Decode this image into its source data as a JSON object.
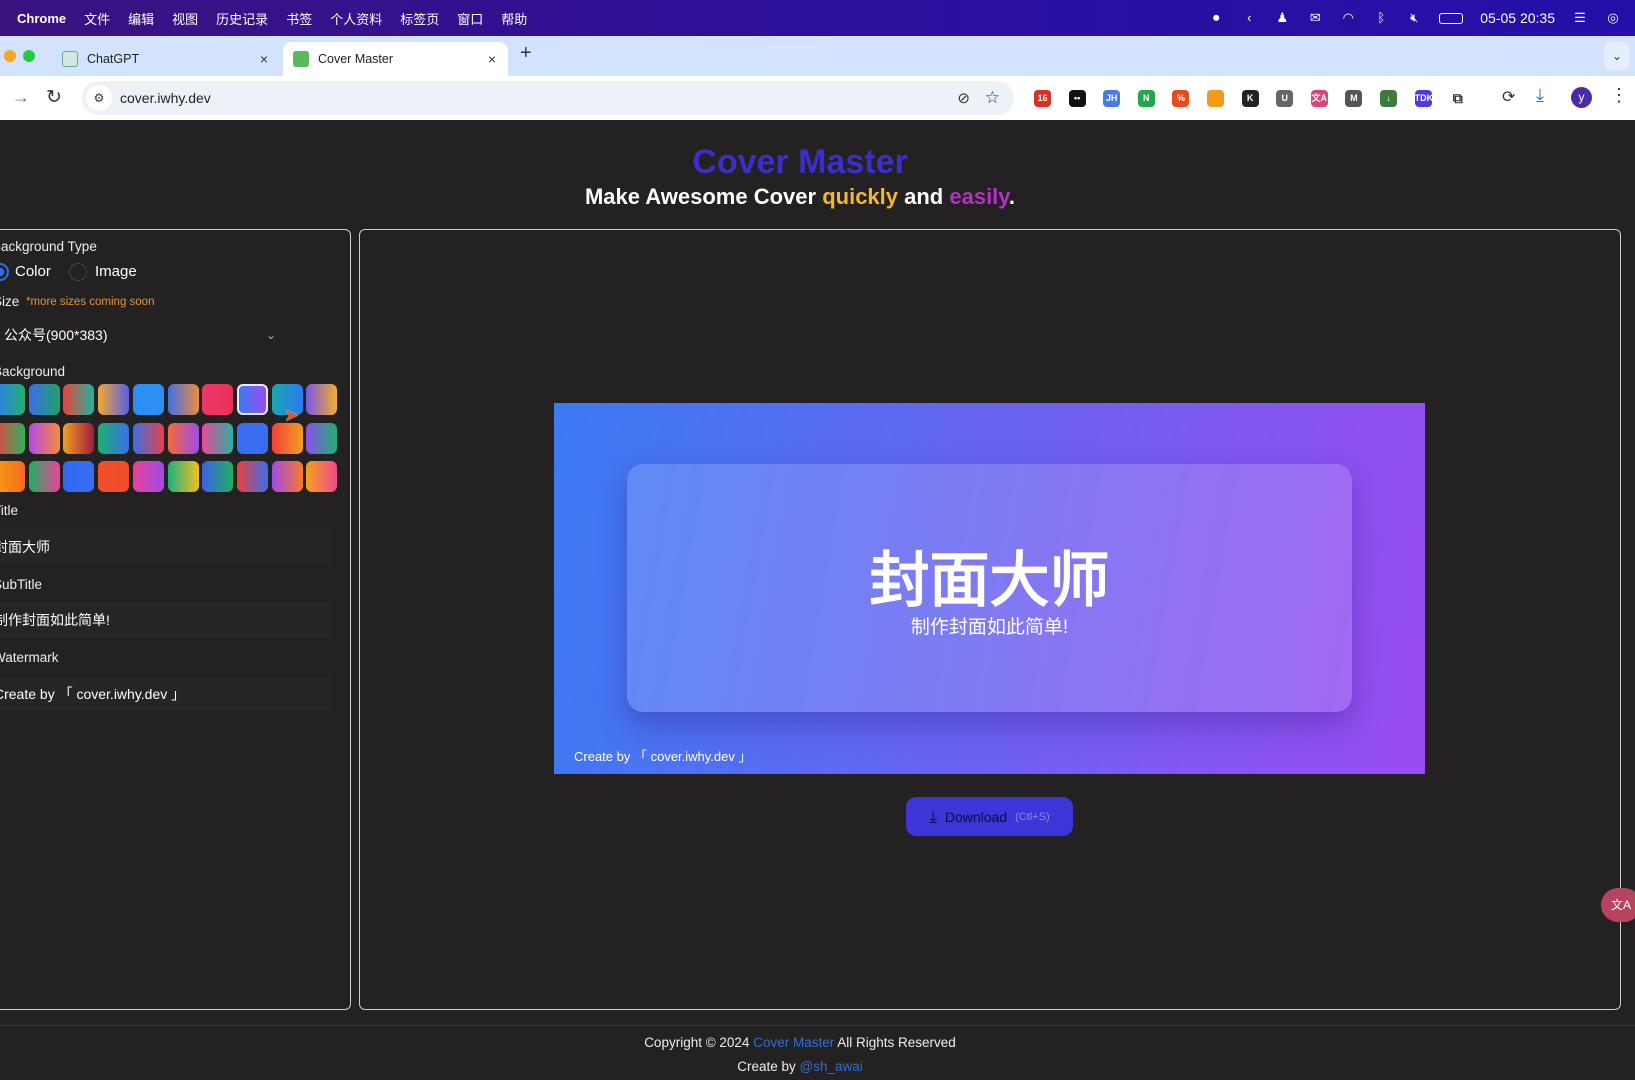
{
  "menubar": {
    "app": "Chrome",
    "items": [
      "文件",
      "编辑",
      "视图",
      "历史记录",
      "书签",
      "个人资料",
      "标签页",
      "窗口",
      "帮助"
    ],
    "clock": "05-05 20:35"
  },
  "tabs": [
    {
      "label": "ChatGPT",
      "close": "×"
    },
    {
      "label": "Cover Master",
      "close": "×"
    }
  ],
  "new_tab": "+",
  "address": {
    "url": "cover.iwhy.dev"
  },
  "extensions": [
    {
      "name": "badge-extension-icon",
      "text": "16",
      "color": "#d93025"
    },
    {
      "name": "glasses-extension-icon",
      "text": "••",
      "color": "#111"
    },
    {
      "name": "jh-extension-icon",
      "text": "JH",
      "color": "#4a7be0"
    },
    {
      "name": "n-extension-icon",
      "text": "N",
      "color": "#22a84a"
    },
    {
      "name": "percent-extension-icon",
      "text": "%",
      "color": "#e84a1a"
    },
    {
      "name": "swirl-extension-icon",
      "text": "",
      "color": "#f29a1a"
    },
    {
      "name": "k-extension-icon",
      "text": "K",
      "color": "#222"
    },
    {
      "name": "shield-extension-icon",
      "text": "U",
      "color": "#666"
    },
    {
      "name": "translate-extension-icon",
      "text": "文A",
      "color": "#d9467a"
    },
    {
      "name": "m-extension-icon",
      "text": "M",
      "color": "#555"
    },
    {
      "name": "mic-extension-icon",
      "text": "↓",
      "color": "#3d7a3d"
    },
    {
      "name": "tdk-extension-icon",
      "text": "TDK",
      "color": "#4a3ae0"
    },
    {
      "name": "puzzle-extension-icon",
      "text": "⧉",
      "color": "#fff"
    }
  ],
  "profile": "y",
  "header": {
    "brand": "Cover Master",
    "tag_pre": "Make Awesome Cover ",
    "tag_q": "quickly",
    "tag_mid": " and ",
    "tag_e": "easily",
    "tag_end": ".",
    "accent": "#3b2fc9",
    "quick_color": "#f5b731",
    "easy_color": "#b630c8"
  },
  "form": {
    "bg_type_label": "Background Type",
    "bg_type_options": [
      "Color",
      "Image"
    ],
    "bg_type_selected": "Color",
    "size_label": "Size",
    "size_note": "*more sizes coming soon",
    "size_value": "公众号(900*383)",
    "background_label": "Background",
    "swatches": [
      [
        "#2f7bf5",
        "#22b06a"
      ],
      [
        "#3a6ee8",
        "#1fa26a"
      ],
      [
        "#e8433a",
        "#20b3a0"
      ],
      [
        "#f2a830",
        "#5a5ee8"
      ],
      [
        "#2b8ff2",
        "#2f8ff5"
      ],
      [
        "#3f6fe8",
        "#f28a3a"
      ],
      [
        "#f0366a",
        "#e8305a"
      ],
      [
        "#3b7bf3",
        "#9a4cf0"
      ],
      [
        "#18a8b0",
        "#2a7af0"
      ],
      [
        "#7a55e8",
        "#f2b02a"
      ],
      [
        "#e84040",
        "#30b060"
      ],
      [
        "#b04ae8",
        "#f88a3a"
      ],
      [
        "#f2a020",
        "#a01a40"
      ],
      [
        "#20b070",
        "#3a6ee8"
      ],
      [
        "#3a6ee8",
        "#e8404a"
      ],
      [
        "#f26a3a",
        "#a04ae8"
      ],
      [
        "#e84a9a",
        "#2ab0a0"
      ],
      [
        "#3a6ef0",
        "#3a6ef0"
      ],
      [
        "#f0403a",
        "#f2a020"
      ],
      [
        "#8a50e8",
        "#20b070"
      ],
      [
        "#f2a010",
        "#f86a20"
      ],
      [
        "#20b060",
        "#f0409a"
      ],
      [
        "#2f68f5",
        "#3a6ef0"
      ],
      [
        "#f0502a",
        "#f04a2a"
      ],
      [
        "#e8409a",
        "#a04ae8"
      ],
      [
        "#20b080",
        "#f2c020"
      ],
      [
        "#3a60e8",
        "#20b060"
      ],
      [
        "#e8403a",
        "#3a6ef0"
      ],
      [
        "#a04ae8",
        "#f87a2a"
      ],
      [
        "#f2a020",
        "#f04a8a"
      ]
    ],
    "selected_swatch": 7,
    "title_label": "Title",
    "title_value": "封面大师",
    "subtitle_label": "SubTitle",
    "subtitle_value": "制作封面如此简单!",
    "watermark_label": "Watermark",
    "watermark_value": "Create by 「 cover.iwhy.dev 」"
  },
  "preview": {
    "title": "封面大师",
    "subtitle": "制作封面如此简单!",
    "watermark": "Create by 「 cover.iwhy.dev 」"
  },
  "download": {
    "label": "Download",
    "shortcut": "(Ctl+S)"
  },
  "footer": {
    "copy_pre": "Copyright © 2024 ",
    "copy_link": "Cover Master",
    "copy_post": " All Rights Reserved",
    "create_pre": "Create by ",
    "create_link": "@sh_awai"
  }
}
